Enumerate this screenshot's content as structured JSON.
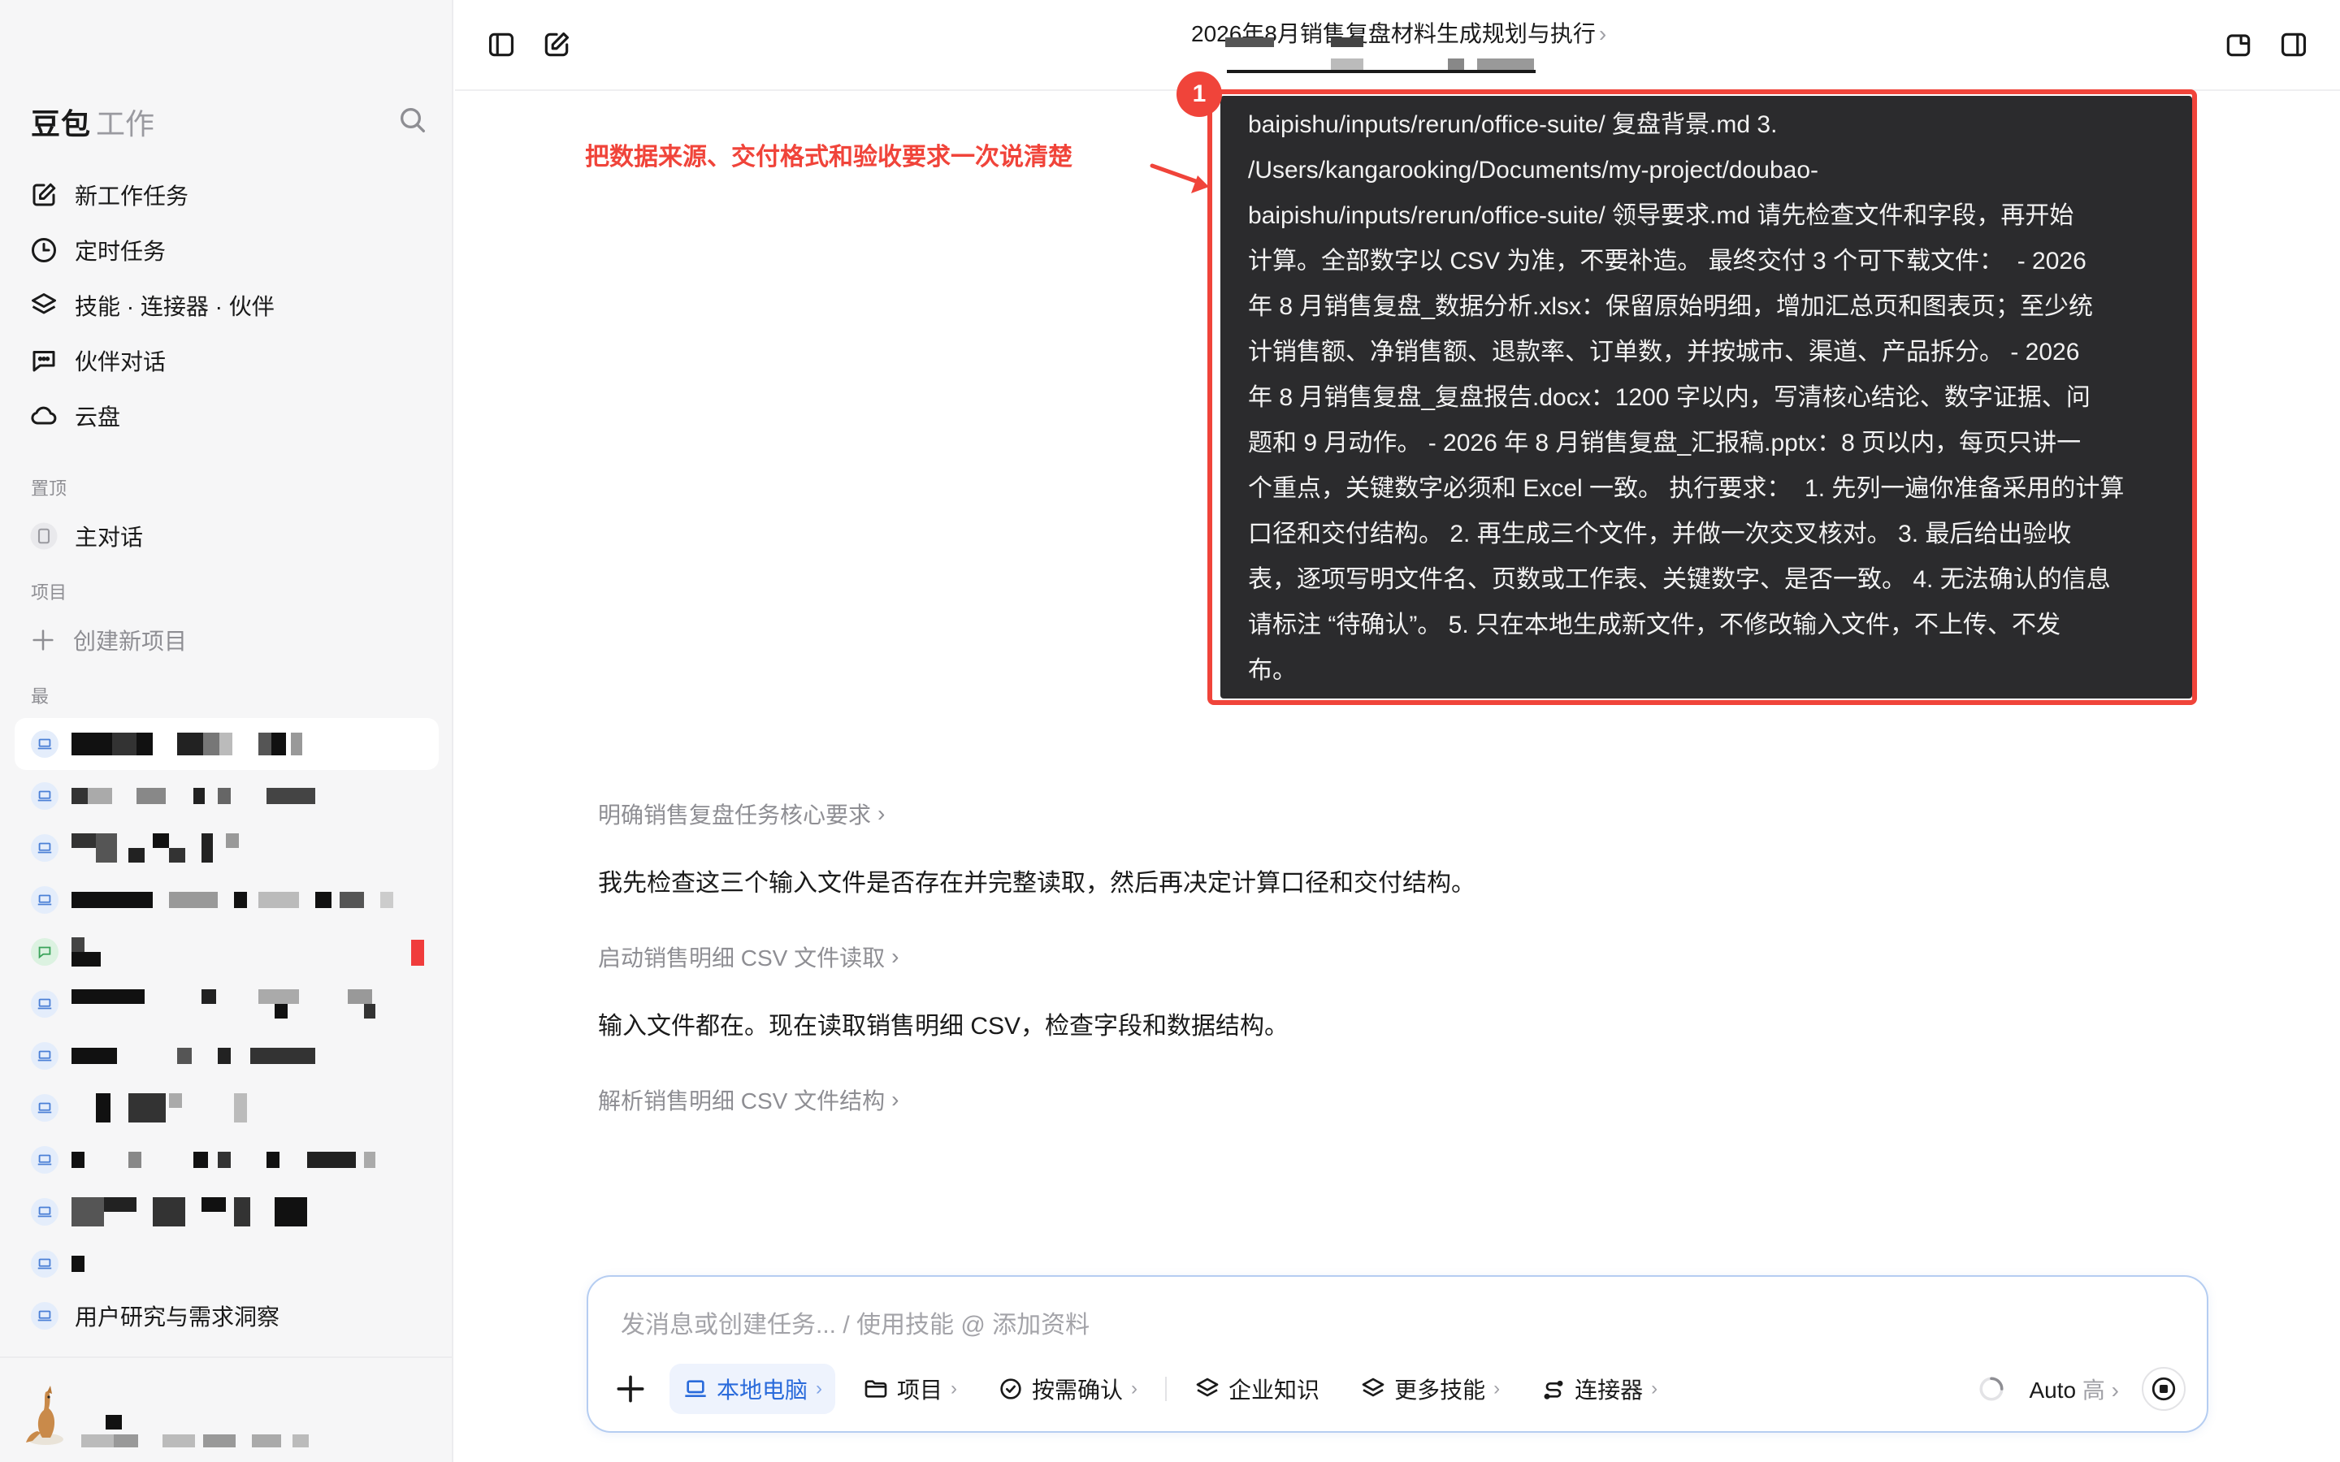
{
  "sidebar": {
    "brand_name": "豆包",
    "brand_sub": "工作",
    "nav": [
      {
        "label": "新工作任务",
        "icon": "edit-icon"
      },
      {
        "label": "定时任务",
        "icon": "clock-icon"
      },
      {
        "label": "技能 · 连接器 · 伙伴",
        "icon": "layers-icon"
      },
      {
        "label": "伙伴对话",
        "icon": "chat-icon"
      },
      {
        "label": "云盘",
        "icon": "cloud-icon"
      }
    ],
    "pinned_title": "置顶",
    "pinned_item": "主对话",
    "projects_title": "项目",
    "new_project": "创建新项目",
    "recent_title": "最近",
    "recent_last": "用户研究与需求洞察"
  },
  "header": {
    "title": "2026年8月销售复盘材料生成规划与执行",
    "chevron": "›"
  },
  "annotation": {
    "label": "把数据来源、交付格式和验收要求一次说清楚",
    "badge": "1"
  },
  "prompt": {
    "text": "baipishu/inputs/rerun/office-suite/ 复盘背景.md 3.\n/Users/kangarooking/Documents/my-project/doubao-\nbaipishu/inputs/rerun/office-suite/ 领导要求.md 请先检查文件和字段，再开始\n计算。全部数字以 CSV 为准，不要补造。 最终交付 3 个可下载文件：  - 2026\n年 8 月销售复盘_数据分析.xlsx：保留原始明细，增加汇总页和图表页；至少统\n计销售额、净销售额、退款率、订单数，并按城市、渠道、产品拆分。 - 2026\n年 8 月销售复盘_复盘报告.docx：1200 字以内，写清核心结论、数字证据、问\n题和 9 月动作。 - 2026 年 8 月销售复盘_汇报稿.pptx：8 页以内，每页只讲一\n个重点，关键数字必须和 Excel 一致。 执行要求：  1. 先列一遍你准备采用的计算\n口径和交付结构。 2. 再生成三个文件，并做一次交叉核对。 3. 最后给出验收\n表，逐项写明文件名、页数或工作表、关键数字、是否一致。 4. 无法确认的信息\n请标注 “待确认”。 5. 只在本地生成新文件，不修改输入文件，不上传、不发\n布。"
  },
  "conversation": {
    "step1": "明确销售复盘任务核心要求",
    "msg1": "我先检查这三个输入文件是否存在并完整读取，然后再决定计算口径和交付结构。",
    "step2": "启动销售明细 CSV 文件读取",
    "msg2": "输入文件都在。现在读取销售明细 CSV，检查字段和数据结构。",
    "step3": "解析销售明细 CSV 文件结构",
    "chevron": "›"
  },
  "composer": {
    "placeholder": "发消息或创建任务... / 使用技能 @ 添加资料",
    "chips": {
      "local": "本地电脑",
      "project": "项目",
      "confirm": "按需确认",
      "knowledge": "企业知识",
      "skills": "更多技能",
      "connector": "连接器"
    },
    "chevron": "›",
    "model": "Auto",
    "model_level": "高"
  },
  "colors": {
    "accent_red": "#f0443a",
    "accent_blue": "#2a6bdb",
    "prompt_bg": "#2b2b2d"
  }
}
